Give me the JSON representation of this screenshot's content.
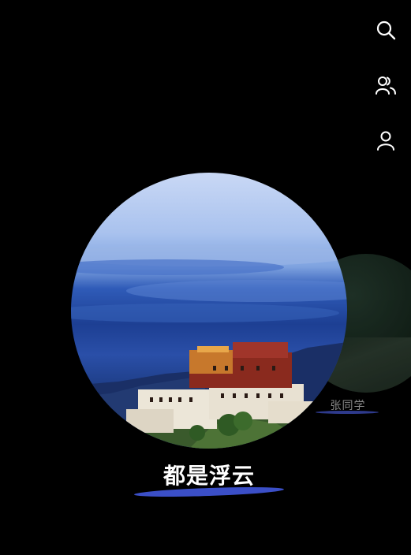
{
  "toolbar": {
    "items": [
      {
        "icon": "search-icon"
      },
      {
        "icon": "group-icon"
      },
      {
        "icon": "person-icon"
      }
    ]
  },
  "cards": {
    "main": {
      "title": "都是浮云",
      "underline_color": "#3b4fc7"
    },
    "secondary": {
      "title": "张同学",
      "underline_color": "#2e3a8c"
    }
  },
  "colors": {
    "background": "#000000",
    "icon": "#ffffff",
    "accent": "#3b4fc7"
  }
}
